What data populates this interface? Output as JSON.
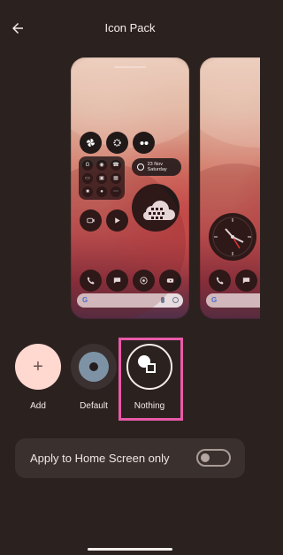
{
  "header": {
    "title": "Icon Pack",
    "back_icon": "back-arrow-icon"
  },
  "preview": {
    "date_label": "23 Nov Saturday",
    "search_icons": [
      "google-icon",
      "mic-icon",
      "lens-icon"
    ],
    "left_card": {
      "top_icons": [
        "pinwheel-icon",
        "gear-icon",
        "tape-icon"
      ],
      "mini_icons": [
        "google-icon",
        "broadcast-icon",
        "phone-icon",
        "file-icon",
        "lock-icon",
        "grid-icon",
        "box-icon",
        "user-icon",
        "more-icon"
      ],
      "apps": [
        "phone-icon",
        "chat-icon",
        "chrome-icon",
        "youtube-icon"
      ],
      "side_icons": [
        "camera-icon",
        "play-store-icon"
      ],
      "widget_icon": "cloud-icon"
    },
    "right_card": {
      "widget": "analog-clock",
      "apps": [
        "phone-icon",
        "chat-icon"
      ]
    }
  },
  "packs": [
    {
      "label": "Add",
      "icon": "plus-icon"
    },
    {
      "label": "Default",
      "icon": "dot-icon"
    },
    {
      "label": "Nothing",
      "icon": "nothing-icon",
      "selected": true
    }
  ],
  "settings": {
    "apply_home_only_label": "Apply to Home Screen only",
    "apply_home_only_on": false
  },
  "colors": {
    "background": "#2b2220",
    "accent_outline": "#ea5aa9",
    "add_circle": "#ffd8d0",
    "default_circle": "#3a3130",
    "nothing_circle": "#2b2220"
  }
}
